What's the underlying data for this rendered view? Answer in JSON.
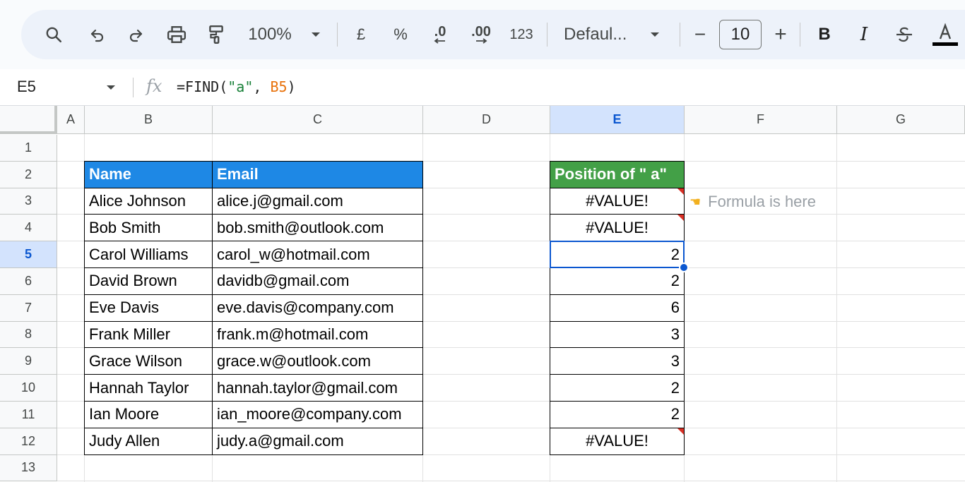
{
  "toolbar": {
    "zoom": "100%",
    "currency": "£",
    "percent": "%",
    "decrease_decimal": ".0",
    "increase_decimal": ".00",
    "number_format": "123",
    "font_name": "Defaul...",
    "font_size": "10",
    "minus": "−",
    "plus": "+",
    "bold": "B",
    "italic": "I"
  },
  "formula_bar": {
    "cell_ref": "E5",
    "fx": "fx",
    "formula_prefix": "=FIND(",
    "formula_string": "\"a\"",
    "formula_sep": ", ",
    "formula_ref": "B5",
    "formula_suffix": ")"
  },
  "columns": [
    "A",
    "B",
    "C",
    "D",
    "E",
    "F",
    "G"
  ],
  "selected_column": "E",
  "rows": [
    "1",
    "2",
    "3",
    "4",
    "5",
    "6",
    "7",
    "8",
    "9",
    "10",
    "11",
    "12",
    "13"
  ],
  "selected_row": "5",
  "table": {
    "header_name": "Name",
    "header_email": "Email",
    "header_position": "Position of \" a\"",
    "records": [
      {
        "name": "Alice Johnson",
        "email": "alice.j@gmail.com",
        "position": "#VALUE!"
      },
      {
        "name": "Bob Smith",
        "email": "bob.smith@outlook.com",
        "position": "#VALUE!"
      },
      {
        "name": "Carol Williams",
        "email": "carol_w@hotmail.com",
        "position": "2"
      },
      {
        "name": "David Brown",
        "email": "davidb@gmail.com",
        "position": "2"
      },
      {
        "name": "Eve Davis",
        "email": "eve.davis@company.com",
        "position": "6"
      },
      {
        "name": "Frank Miller",
        "email": "frank.m@hotmail.com",
        "position": "3"
      },
      {
        "name": "Grace Wilson",
        "email": "grace.w@outlook.com",
        "position": "3"
      },
      {
        "name": "Hannah Taylor",
        "email": "hannah.taylor@gmail.com",
        "position": "2"
      },
      {
        "name": "Ian Moore",
        "email": "ian_moore@company.com",
        "position": "2"
      },
      {
        "name": "Judy Allen",
        "email": "judy.a@gmail.com",
        "position": "#VALUE!"
      }
    ]
  },
  "note": {
    "icon": "pointing-hand-icon",
    "text": "Formula is here"
  },
  "colors": {
    "header_blue": "#1e88e5",
    "header_green": "#43a047",
    "selection": "#0b57d0",
    "error_marker": "#d93025"
  }
}
